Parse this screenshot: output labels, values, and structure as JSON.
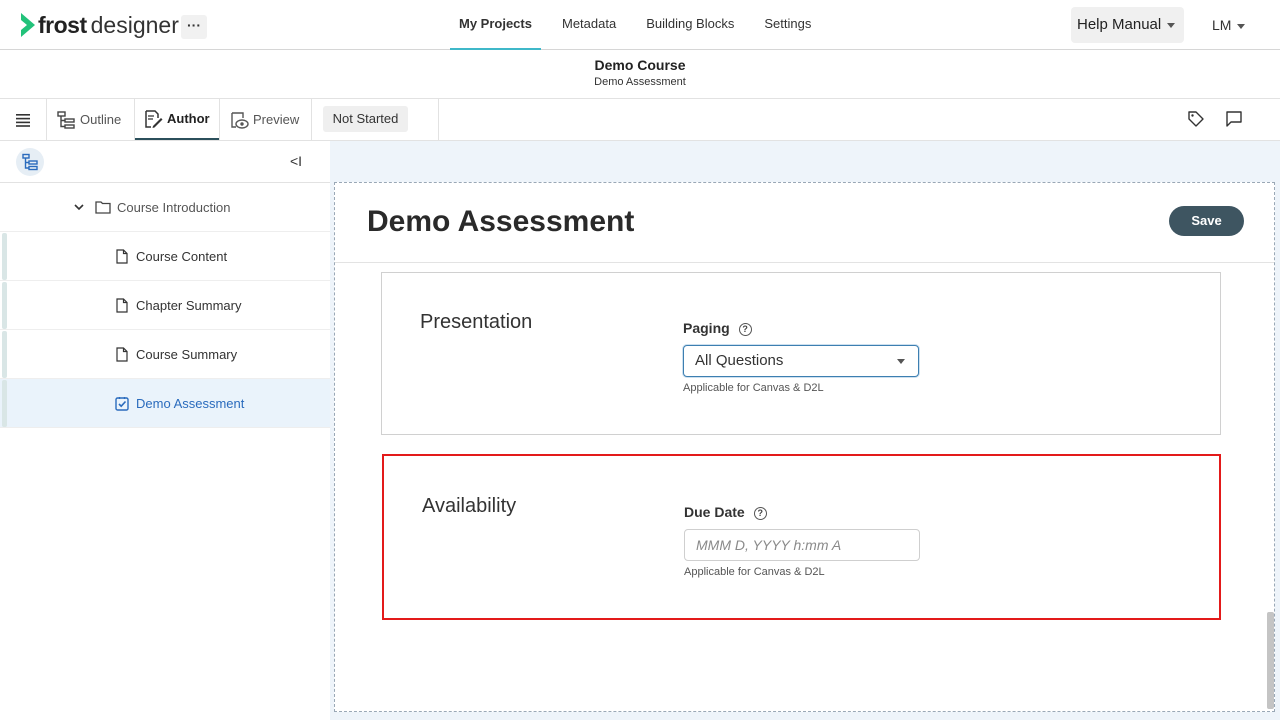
{
  "app": {
    "logo_text_bold": "frost",
    "logo_text": "designer",
    "more_label": "···",
    "nav": [
      "My Projects",
      "Metadata",
      "Building Blocks",
      "Settings"
    ],
    "help_label": "Help Manual",
    "user_initials": "LM"
  },
  "course": {
    "title": "Demo Course",
    "subtitle": "Demo Assessment"
  },
  "toolbar": {
    "tabs": [
      "Outline",
      "Author",
      "Preview"
    ],
    "status": "Not Started"
  },
  "sidebar": {
    "collapse_glyph": "<I",
    "parent_label": "Course Introduction",
    "items": [
      {
        "label": "Course Content",
        "type": "page"
      },
      {
        "label": "Chapter Summary",
        "type": "page"
      },
      {
        "label": "Course Summary",
        "type": "page"
      },
      {
        "label": "Demo Assessment",
        "type": "assessment"
      }
    ]
  },
  "editor": {
    "title": "Demo Assessment",
    "save_label": "Save",
    "presentation": {
      "heading": "Presentation",
      "field_label": "Paging",
      "value": "All Questions",
      "hint": "Applicable for Canvas & D2L"
    },
    "availability": {
      "heading": "Availability",
      "field_label": "Due Date",
      "placeholder": "MMM D, YYYY h:mm A",
      "hint": "Applicable for Canvas & D2L"
    }
  },
  "colors": {
    "accent": "#3fb8c9",
    "save_button": "#3e5561",
    "highlight_box": "#e31a1a",
    "active_link": "#2a6bbd"
  }
}
